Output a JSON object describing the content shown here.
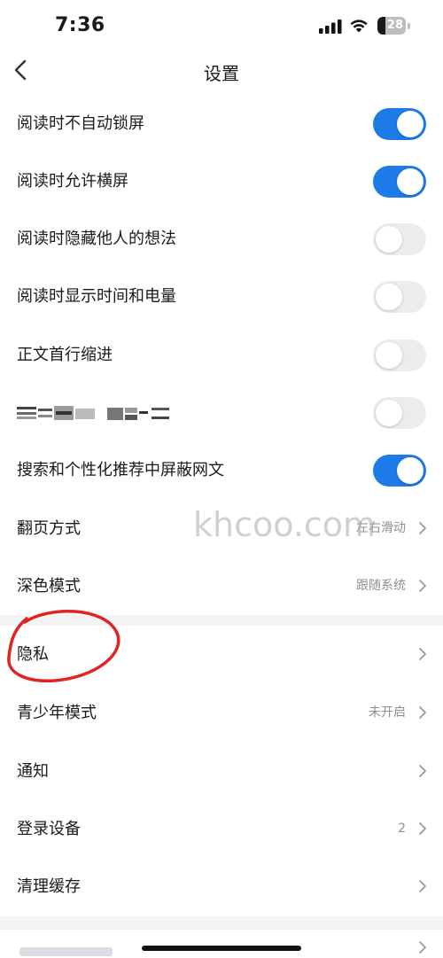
{
  "status": {
    "time": "7:36",
    "battery": 28
  },
  "nav": {
    "title": "设置"
  },
  "settings": [
    {
      "label": "阅读时不自动锁屏",
      "on": true
    },
    {
      "label": "阅读时允许横屏",
      "on": true
    },
    {
      "label": "阅读时隐藏他人的想法",
      "on": false
    },
    {
      "label": "阅读时显示时间和电量",
      "on": false
    },
    {
      "label": "正文首行缩进",
      "on": false
    },
    {
      "label": "",
      "on": false
    },
    {
      "label": "搜索和个性化推荐中屏蔽网文",
      "on": true
    },
    {
      "label": "翻页方式",
      "value": "左右滑动"
    },
    {
      "label": "深色模式",
      "value": "跟随系统"
    }
  ],
  "settings2": [
    {
      "label": "隐私",
      "value": ""
    },
    {
      "label": "青少年模式",
      "value": "未开启"
    },
    {
      "label": "通知",
      "value": ""
    },
    {
      "label": "登录设备",
      "value": "2"
    },
    {
      "label": "清理缓存",
      "value": ""
    }
  ],
  "watermark": "khcoo.com",
  "colors": {
    "toggle_on": "#1d7be8",
    "toggle_off": "#ececec",
    "annotation": "#e02424"
  }
}
